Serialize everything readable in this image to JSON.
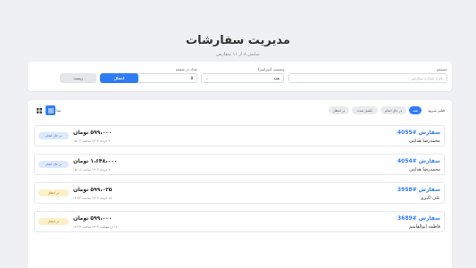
{
  "page": {
    "title": "مدیریت سفارشات",
    "subtitle": "نمایش ۸ از ۱۱ سفارش"
  },
  "filters": {
    "search_label": "جستجو",
    "search_placeholder": "نام یا شماره سفارش...",
    "status_label": "وضعیت (سراسر)",
    "status_value": "همه",
    "page_size_label": "تعداد در صفحه",
    "page_size_value": "8",
    "apply_label": "اعمال",
    "reset_label": "ریست"
  },
  "toolbar": {
    "filter_label": "فیلتر سریع:",
    "chips": [
      "همه",
      "در حال انجام",
      "تکمیل شده",
      "در انتظار"
    ],
    "active_chip": "همه",
    "view_label": "نما:"
  },
  "orders": [
    {
      "id": "سفارش #4055",
      "customer": "محمدرضا هدایتی",
      "amount": "۵۹۹،۰۰۰ تومان",
      "date": "۴ خرداد ۱۴۰۴ ساعت ۱۵:۰۲",
      "status": "در حال انجام",
      "status_type": "processing"
    },
    {
      "id": "سفارش #4054",
      "customer": "محمدرضا هدایتی",
      "amount": "۱،۶۴۸،۰۰۰ تومان",
      "date": "۲ خرداد ۱۴۰۴ ساعت ۱۵:۰۸",
      "status": "در حال انجام",
      "status_type": "processing"
    },
    {
      "id": "سفارش #3958",
      "customer": "علی اکبری",
      "amount": "۵۹۹،۰۳۵ تومان",
      "date": "۱۸ خرداد ۱۴۰۴ ساعت ۱۳:۳۳",
      "status": "در انتظار",
      "status_type": "pending"
    },
    {
      "id": "سفارش #3689",
      "customer": "فاطمه ابوالقاسم",
      "amount": "۵۹۹،۰۰۰ تومان",
      "date": "۱۶ اردیبهشت ۱۴۰۴ ساعت ۱۶:۲۹",
      "status": "در انتظار",
      "status_type": "pending"
    }
  ],
  "colors": {
    "accent": "#2f7cf6",
    "processing_bg": "#dde9fb",
    "pending_bg": "#fdf0c8"
  },
  "icons": {
    "select_chevron": "chevron-down-icon",
    "list_view": "list-view-icon",
    "grid_view": "grid-view-icon"
  }
}
